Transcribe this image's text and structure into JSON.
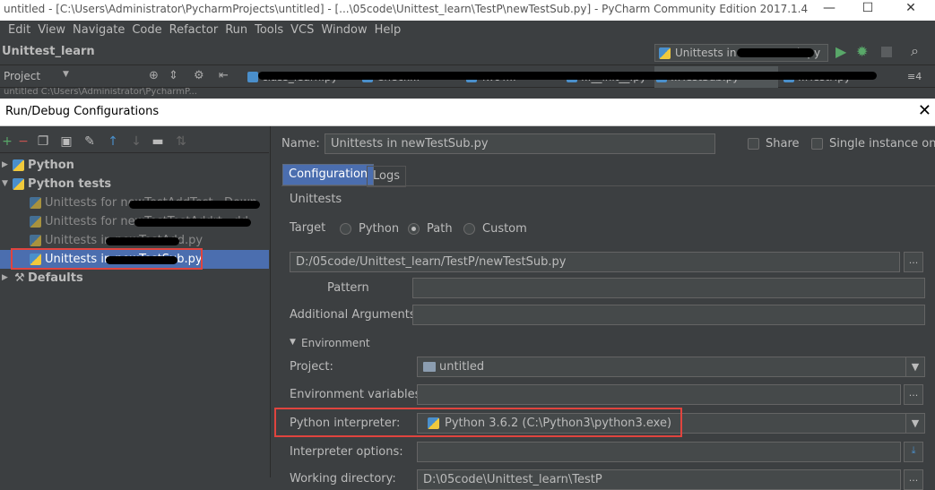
{
  "window": {
    "title": "untitled - [C:\\Users\\Administrator\\PycharmProjects\\untitled] - [...\\05code\\Unittest_learn\\TestP\\newTestSub.py] - PyCharm Community Edition 2017.1.4",
    "min_glyph": "—",
    "max_glyph": "☐",
    "close_glyph": "✕"
  },
  "menu": [
    "Edit",
    "View",
    "Navigate",
    "Code",
    "Refactor",
    "Run",
    "Tools",
    "VCS",
    "Window",
    "Help"
  ],
  "toolbar": {
    "project_name": "Unittest_learn",
    "run_config": "Unittests in newTestSub.py"
  },
  "tabs": {
    "project_label": "Project",
    "items": [
      "class_learn.py",
      "Check...",
      "TwoT...",
      "...__init__.py",
      "...TestSub.py",
      "...TestP.py"
    ],
    "overflow": "≡4"
  },
  "path_row": "untitled  C:\\Users\\Administrator\\PycharmP...",
  "dialog": {
    "title": "Run/Debug Configurations",
    "close": "✕"
  },
  "tree": {
    "python": "Python",
    "python_tests": "Python tests",
    "items": [
      "Unittests for newTestAddTest...Down",
      "Unittests for newTestTestAddrt...dd",
      "Unittests in newTestAdd.py",
      "Unittests in newTestSub.py"
    ],
    "defaults": "Defaults"
  },
  "form": {
    "name_label": "Name:",
    "name_value": "Unittests in newTestSub.py",
    "share_label": "Share",
    "single_instance_label": "Single instance only",
    "tab_configuration": "Configuration",
    "tab_logs": "Logs",
    "section": "Unittests",
    "target_label": "Target",
    "target_options": [
      "Python",
      "Path",
      "Custom"
    ],
    "target_selected": "Path",
    "path_value": "D:/05code/Unittest_learn/TestP/newTestSub.py",
    "pattern_label": "Pattern",
    "pattern_value": "",
    "additional_args_label": "Additional Arguments",
    "additional_args_value": "",
    "environment_label": "Environment",
    "project_label": "Project:",
    "project_value": "untitled",
    "env_vars_label": "Environment variables:",
    "env_vars_value": "",
    "interpreter_label": "Python interpreter:",
    "interpreter_value": "Python 3.6.2 (C:\\Python3\\python3.exe)",
    "interpreter_options_label": "Interpreter options:",
    "interpreter_options_value": "",
    "working_dir_label": "Working directory:",
    "working_dir_value": "D:\\05code\\Unittest_learn\\TestP",
    "dots": "...",
    "dropdown_arrow": "▼"
  },
  "colors": {
    "background": "#3c3f41",
    "selection": "#4b6eaf",
    "highlight_box": "#e0443e",
    "run_green": "#59a869"
  }
}
